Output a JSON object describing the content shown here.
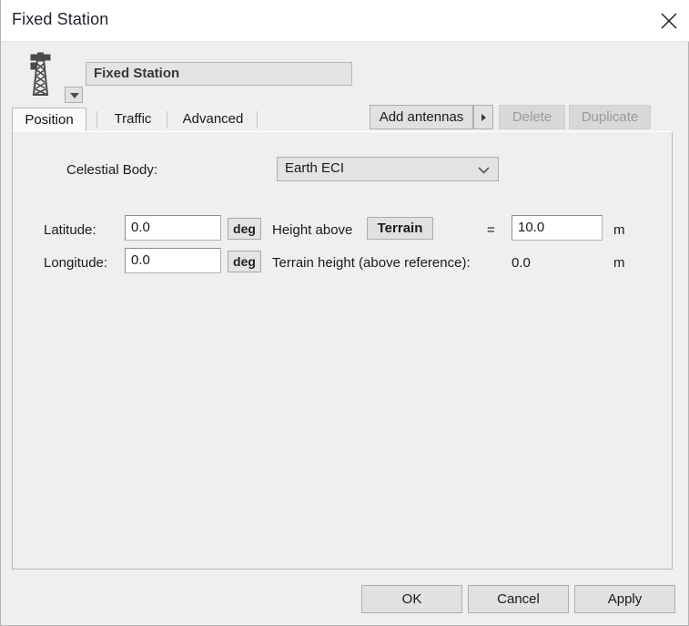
{
  "window": {
    "title": "Fixed Station",
    "close_icon": "close-icon"
  },
  "header": {
    "icon": "antenna-tower-icon",
    "icon_dropdown": "chevron-down-icon",
    "name_value": "Fixed Station",
    "buttons": {
      "add_antennas": "Add antennas",
      "add_antennas_arrow": "triangle-right-icon",
      "delete": "Delete",
      "duplicate": "Duplicate"
    }
  },
  "tabs": [
    {
      "label": "Position",
      "selected": true
    },
    {
      "label": "Traffic",
      "selected": false
    },
    {
      "label": "Advanced",
      "selected": false
    }
  ],
  "position_tab": {
    "celestial_body_label": "Celestial Body:",
    "celestial_body_value": "Earth ECI",
    "celestial_body_chevron": "chevron-down-icon",
    "latitude_label": "Latitude:",
    "latitude_value": "0.0",
    "latitude_unit": "deg",
    "longitude_label": "Longitude:",
    "longitude_value": "0.0",
    "longitude_unit": "deg",
    "height_above_label": "Height above",
    "height_reference": "Terrain",
    "equals": "=",
    "height_value": "10.0",
    "height_unit": "m",
    "terrain_height_label": "Terrain height (above reference):",
    "terrain_height_value": "0.0",
    "terrain_height_unit": "m"
  },
  "footer": {
    "ok": "OK",
    "cancel": "Cancel",
    "apply": "Apply"
  },
  "colors": {
    "window_background": "#efefef",
    "titlebar_background": "#ffffff",
    "panel_background": "#efefef",
    "button_face": "#e1e1e1",
    "button_border": "#adadad",
    "disabled_text": "#9b9b9b",
    "text": "#1a1a1a",
    "name_field_text": "#3a3632",
    "tower_icon": "#4a4a4a"
  }
}
